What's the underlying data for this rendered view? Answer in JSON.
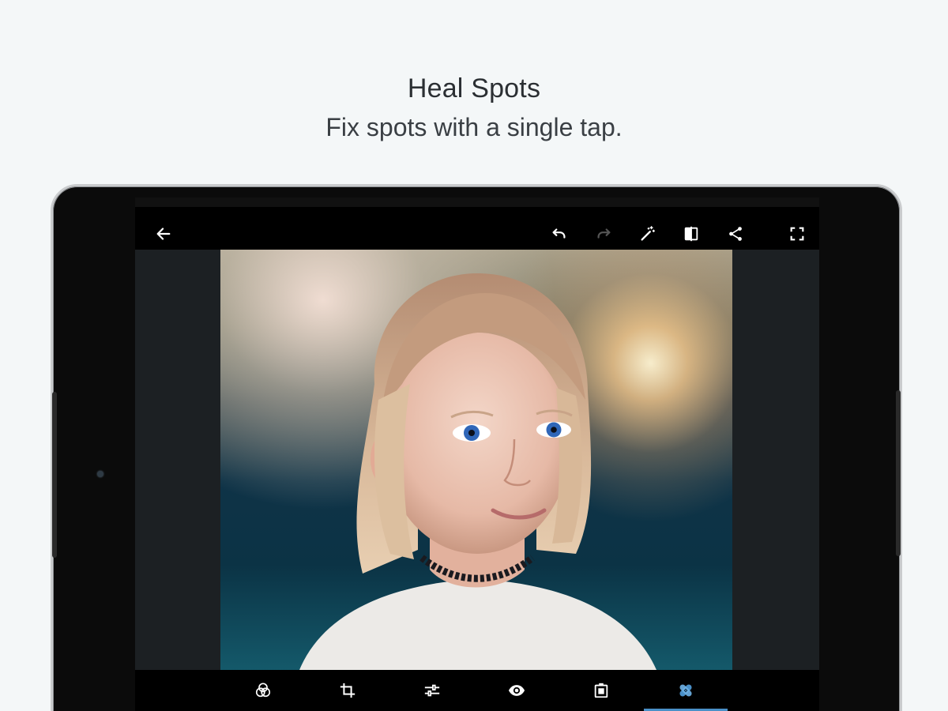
{
  "promo": {
    "title": "Heal Spots",
    "subtitle": "Fix spots with a single tap."
  },
  "toolbar": {
    "icons": [
      "back-arrow-icon",
      "undo-icon",
      "redo-icon",
      "magic-wand-icon",
      "compare-icon",
      "share-icon",
      "fullscreen-icon"
    ],
    "redo_enabled": false
  },
  "bottom_tools": {
    "items": [
      "looks-icon",
      "crop-icon",
      "adjustments-icon",
      "red-eye-icon",
      "frame-icon",
      "spot-heal-icon"
    ],
    "active": "spot-heal-icon",
    "active_color": "#4a90c8"
  },
  "colors": {
    "page_background": "#f4f7f8",
    "tablet_body": "#0b0b0b",
    "editor_background": "#1c2023",
    "icon_color": "#ffffff",
    "disabled_icon_color": "#555555"
  }
}
